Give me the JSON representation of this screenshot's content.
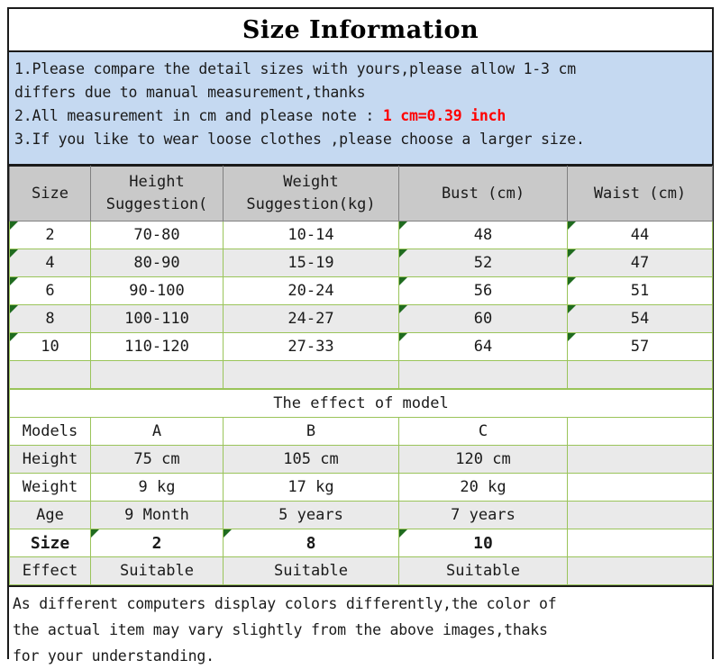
{
  "title": "Size Information",
  "notes": {
    "line1": "1.Please compare the detail sizes with yours,please allow 1-3 cm",
    "line2": "differs due to manual measurement,thanks",
    "line3_prefix": "2.All measurement in cm and please note : ",
    "line3_red": "1 cm=0.39 inch",
    "line4": "3.If you like to wear loose clothes ,please choose a larger size."
  },
  "size_table": {
    "headers": [
      "Size",
      "Height Suggestion(",
      "Weight Suggestion(kg)",
      "Bust (cm)",
      "Waist (cm)"
    ],
    "headers_split": {
      "h2_line1": "Height",
      "h2_line2": "Suggestion(",
      "h3_line1": "Weight",
      "h3_line2": "Suggestion(kg)"
    },
    "rows": [
      {
        "size": "2",
        "height": "70-80",
        "weight": "10-14",
        "bust": "48",
        "waist": "44"
      },
      {
        "size": "4",
        "height": "80-90",
        "weight": "15-19",
        "bust": "52",
        "waist": "47"
      },
      {
        "size": "6",
        "height": "90-100",
        "weight": "20-24",
        "bust": "56",
        "waist": "51"
      },
      {
        "size": "8",
        "height": "100-110",
        "weight": "24-27",
        "bust": "60",
        "waist": "54"
      },
      {
        "size": "10",
        "height": "110-120",
        "weight": "27-33",
        "bust": "64",
        "waist": "57"
      }
    ]
  },
  "model_section": {
    "banner": "The effect of model",
    "rows": [
      {
        "label": "Models",
        "a": "A",
        "b": "B",
        "c": "C",
        "d": ""
      },
      {
        "label": "Height",
        "a": "75 cm",
        "b": "105 cm",
        "c": "120 cm",
        "d": ""
      },
      {
        "label": "Weight",
        "a": "9 kg",
        "b": "17 kg",
        "c": "20 kg",
        "d": ""
      },
      {
        "label": "Age",
        "a": "9 Month",
        "b": "5 years",
        "c": "7 years",
        "d": ""
      },
      {
        "label": "Size",
        "a": "2",
        "b": "8",
        "c": "10",
        "d": ""
      },
      {
        "label": "Effect",
        "a": "Suitable",
        "b": "Suitable",
        "c": "Suitable",
        "d": ""
      }
    ]
  },
  "footer": {
    "line1": "As different computers display colors differently,the color of",
    "line2": "the actual item may vary slightly from the above images,thaks",
    "line3": "for your understanding."
  },
  "colors": {
    "notes_bg": "#c5d9f1",
    "header_bg": "#c9c9c9",
    "banner_bg": "#f7c093",
    "alt_row_bg": "#eaeaea",
    "grid_green": "#9ac45a",
    "marker_green": "#1f6b1f",
    "accent_red": "#ff0000",
    "frame": "#1a1a1a"
  }
}
